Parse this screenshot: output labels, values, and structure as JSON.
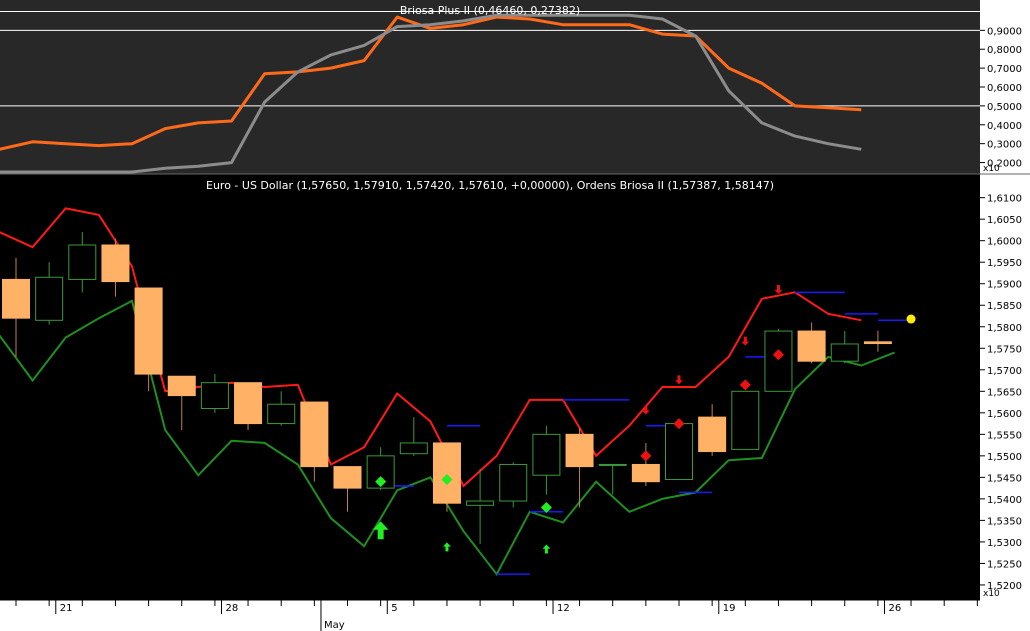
{
  "colors": {
    "upper_bg": "#282828",
    "lower_bg": "#000000",
    "axis_bg": "#ffffff",
    "briosa_a": "#ff6a1a",
    "briosa_b": "#8c8c8c",
    "upper_band": "#ff1a1a",
    "lower_band": "#1f8f1f",
    "body_bear": "#ffb266",
    "body_bull": "#000000",
    "wick": "#3a9a3a",
    "buy_signal": "#22ee22",
    "sell_signal": "#ee1111",
    "target_marker": "#ffee00",
    "level_line": "#1a1aff"
  },
  "chart_data": [
    {
      "type": "line",
      "title": "Briosa Plus II (0,46460, 0,27382)",
      "x_index": [
        0,
        1,
        2,
        3,
        4,
        5,
        6,
        7,
        8,
        9,
        10,
        11,
        12,
        13,
        14,
        15,
        16,
        17,
        18,
        19,
        20,
        21,
        22,
        23,
        24,
        25,
        26
      ],
      "series": [
        {
          "color_key": "briosa_a",
          "values": [
            0.27,
            0.31,
            0.3,
            0.29,
            0.3,
            0.38,
            0.41,
            0.42,
            0.67,
            0.68,
            0.7,
            0.74,
            0.97,
            0.91,
            0.93,
            0.97,
            0.96,
            0.93,
            0.93,
            0.93,
            0.88,
            0.87,
            0.7,
            0.62,
            0.5,
            0.49,
            0.48
          ]
        },
        {
          "color_key": "briosa_b",
          "values": [
            0.15,
            0.15,
            0.15,
            0.15,
            0.15,
            0.17,
            0.18,
            0.2,
            0.52,
            0.68,
            0.77,
            0.82,
            0.92,
            0.93,
            0.95,
            0.98,
            0.98,
            0.98,
            0.98,
            0.98,
            0.96,
            0.87,
            0.58,
            0.41,
            0.34,
            0.3,
            0.27
          ]
        }
      ],
      "y_ticks": [
        "0,9000",
        "0,8000",
        "0,7000",
        "0,6000",
        "0,5000",
        "0,4000",
        "0,3000",
        "0,2000"
      ],
      "y_tick_values": [
        0.9,
        0.8,
        0.7,
        0.6,
        0.5,
        0.4,
        0.3,
        0.2
      ],
      "ylim": [
        0.15,
        1.05
      ],
      "reference_lines": [
        1.0,
        0.9,
        0.5
      ],
      "scale_note": "x10"
    },
    {
      "type": "candlestick",
      "title": "Euro - US Dollar (1,57650, 1,57910, 1,57420, 1,57610, +0,00000), Ordens Briosa II (1,57387, 1,58147)",
      "x_ticks": [
        "21",
        "28",
        "5",
        "12",
        "19",
        "26"
      ],
      "x_tick_index": [
        1.2,
        6.2,
        11.2,
        16.2,
        21.2,
        26.2
      ],
      "month_label": "May",
      "month_index": 9.2,
      "y_ticks": [
        "1,6100",
        "1,6050",
        "1,6000",
        "1,5950",
        "1,5900",
        "1,5850",
        "1,5800",
        "1,5750",
        "1,5700",
        "1,5650",
        "1,5600",
        "1,5550",
        "1,5500",
        "1,5450",
        "1,5400",
        "1,5350",
        "1,5300",
        "1,5250",
        "1,5200"
      ],
      "y_tick_values": [
        1.61,
        1.605,
        1.6,
        1.595,
        1.59,
        1.585,
        1.58,
        1.575,
        1.57,
        1.565,
        1.56,
        1.555,
        1.55,
        1.545,
        1.54,
        1.535,
        1.53,
        1.525,
        1.52
      ],
      "ylim": [
        1.5165,
        1.6155
      ],
      "scale_note": "x10",
      "candles": [
        {
          "i": 0,
          "o": 1.591,
          "h": 1.596,
          "l": 1.573,
          "c": 1.582
        },
        {
          "i": 1,
          "o": 1.5815,
          "h": 1.595,
          "l": 1.5805,
          "c": 1.5915
        },
        {
          "i": 2,
          "o": 1.591,
          "h": 1.602,
          "l": 1.588,
          "c": 1.599
        },
        {
          "i": 3,
          "o": 1.599,
          "h": 1.6005,
          "l": 1.587,
          "c": 1.5905
        },
        {
          "i": 4,
          "o": 1.589,
          "h": 1.589,
          "l": 1.565,
          "c": 1.569
        },
        {
          "i": 5,
          "o": 1.5685,
          "h": 1.5685,
          "l": 1.556,
          "c": 1.564
        },
        {
          "i": 6,
          "o": 1.561,
          "h": 1.569,
          "l": 1.56,
          "c": 1.567
        },
        {
          "i": 7,
          "o": 1.567,
          "h": 1.567,
          "l": 1.556,
          "c": 1.5575
        },
        {
          "i": 8,
          "o": 1.5575,
          "h": 1.565,
          "l": 1.557,
          "c": 1.562
        },
        {
          "i": 9,
          "o": 1.5625,
          "h": 1.5625,
          "l": 1.544,
          "c": 1.5475
        },
        {
          "i": 10,
          "o": 1.5475,
          "h": 1.5475,
          "l": 1.537,
          "c": 1.5425
        },
        {
          "i": 11,
          "o": 1.5425,
          "h": 1.552,
          "l": 1.542,
          "c": 1.55
        },
        {
          "i": 12,
          "o": 1.5505,
          "h": 1.559,
          "l": 1.55,
          "c": 1.553
        },
        {
          "i": 13,
          "o": 1.553,
          "h": 1.553,
          "l": 1.537,
          "c": 1.539
        },
        {
          "i": 14,
          "o": 1.5385,
          "h": 1.547,
          "l": 1.5295,
          "c": 1.5395
        },
        {
          "i": 15,
          "o": 1.5395,
          "h": 1.5485,
          "l": 1.538,
          "c": 1.548
        },
        {
          "i": 16,
          "o": 1.5455,
          "h": 1.557,
          "l": 1.541,
          "c": 1.555
        },
        {
          "i": 17,
          "o": 1.555,
          "h": 1.5565,
          "l": 1.538,
          "c": 1.5475
        },
        {
          "i": 18,
          "o": 1.548,
          "h": 1.548,
          "l": 1.541,
          "c": 1.548
        },
        {
          "i": 19,
          "o": 1.548,
          "h": 1.553,
          "l": 1.543,
          "c": 1.544
        },
        {
          "i": 20,
          "o": 1.5445,
          "h": 1.5575,
          "l": 1.5445,
          "c": 1.5575
        },
        {
          "i": 21,
          "o": 1.559,
          "h": 1.562,
          "l": 1.55,
          "c": 1.551
        },
        {
          "i": 22,
          "o": 1.5515,
          "h": 1.565,
          "l": 1.5515,
          "c": 1.565
        },
        {
          "i": 23,
          "o": 1.565,
          "h": 1.5795,
          "l": 1.565,
          "c": 1.579
        },
        {
          "i": 24,
          "o": 1.579,
          "h": 1.581,
          "l": 1.5715,
          "c": 1.572
        },
        {
          "i": 25,
          "o": 1.572,
          "h": 1.579,
          "l": 1.5715,
          "c": 1.576
        },
        {
          "i": 26,
          "o": 1.5765,
          "h": 1.5791,
          "l": 1.5742,
          "c": 1.5761
        }
      ],
      "upper_band": [
        1.602,
        1.5985,
        1.6075,
        1.606,
        1.594,
        1.565,
        1.566,
        1.567,
        1.566,
        1.5665,
        1.548,
        1.552,
        1.5645,
        1.558,
        1.543,
        1.55,
        1.563,
        1.563,
        1.55,
        1.557,
        1.566,
        1.566,
        1.573,
        1.5865,
        1.588,
        1.583,
        1.5815
      ],
      "lower_band": [
        1.578,
        1.5675,
        1.5775,
        1.582,
        1.586,
        1.556,
        1.5455,
        1.5535,
        1.553,
        1.548,
        1.5355,
        1.529,
        1.542,
        1.545,
        1.5325,
        1.5225,
        1.537,
        1.5345,
        1.544,
        1.537,
        1.54,
        1.5415,
        1.549,
        1.5495,
        1.5655,
        1.573,
        1.571,
        1.574
      ],
      "buy_signals": [
        {
          "i": 11,
          "value": 1.544,
          "shape": "diamond"
        },
        {
          "i": 13,
          "value": 1.5445,
          "shape": "diamond"
        },
        {
          "i": 16,
          "value": 1.538,
          "shape": "diamond"
        },
        {
          "i": 11,
          "value": 1.532,
          "shape": "arrow-up-large"
        },
        {
          "i": 13,
          "value": 1.5285,
          "shape": "arrow-up"
        },
        {
          "i": 16,
          "value": 1.528,
          "shape": "arrow-up"
        }
      ],
      "sell_signals": [
        {
          "i": 19,
          "value": 1.55,
          "shape": "diamond"
        },
        {
          "i": 20,
          "value": 1.5575,
          "shape": "diamond"
        },
        {
          "i": 22,
          "value": 1.5665,
          "shape": "diamond"
        },
        {
          "i": 23,
          "value": 1.5735,
          "shape": "diamond"
        },
        {
          "i": 19,
          "value": 1.561,
          "shape": "arrow-down"
        },
        {
          "i": 20,
          "value": 1.568,
          "shape": "arrow-down"
        },
        {
          "i": 22,
          "value": 1.577,
          "shape": "arrow-down"
        },
        {
          "i": 23,
          "value": 1.589,
          "shape": "arrow-down"
        }
      ],
      "level_segments": [
        {
          "from": 11,
          "to": 12,
          "value": 1.543
        },
        {
          "from": 13,
          "to": 14,
          "value": 1.557
        },
        {
          "from": 14.5,
          "to": 15.5,
          "value": 1.5225
        },
        {
          "from": 15.5,
          "to": 16.5,
          "value": 1.537
        },
        {
          "from": 16.5,
          "to": 18.5,
          "value": 1.563
        },
        {
          "from": 19,
          "to": 20,
          "value": 1.557
        },
        {
          "from": 20,
          "to": 21,
          "value": 1.5415
        },
        {
          "from": 22,
          "to": 23,
          "value": 1.573
        },
        {
          "from": 23.5,
          "to": 25,
          "value": 1.588
        },
        {
          "from": 25,
          "to": 26,
          "value": 1.583
        },
        {
          "from": 26,
          "to": 27,
          "value": 1.5815
        }
      ],
      "target_marker": {
        "i": 27,
        "value": 1.5818
      }
    }
  ]
}
